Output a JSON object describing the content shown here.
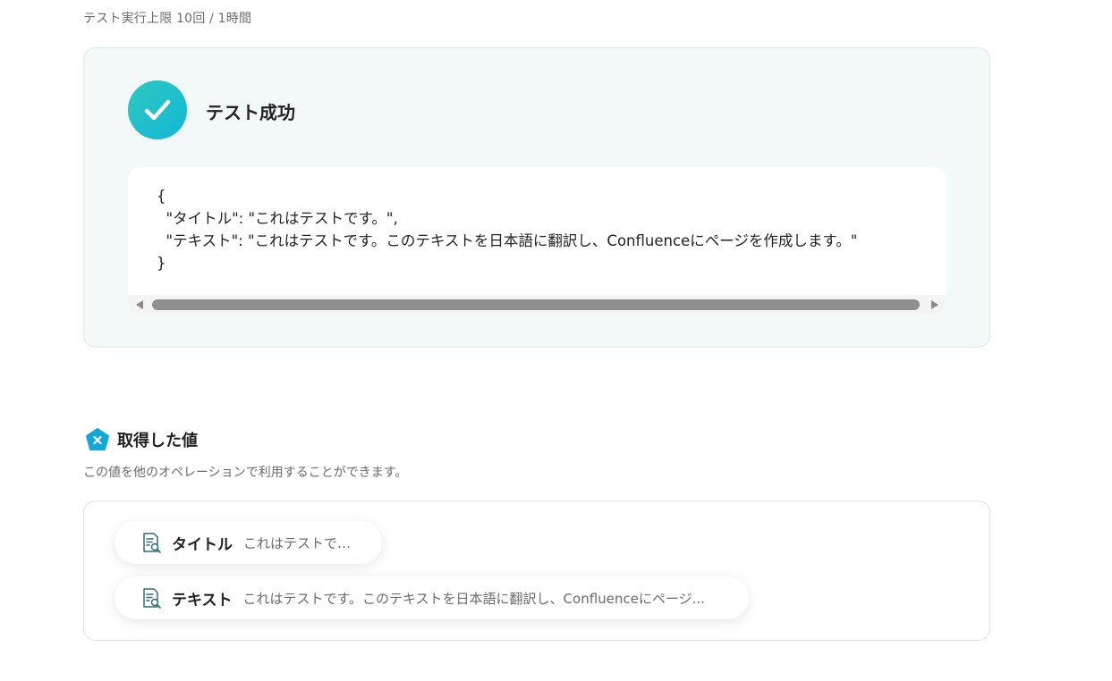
{
  "test_limit": "テスト実行上限 10回 / 1時間",
  "result": {
    "status_title": "テスト成功",
    "json_output": "{\n  \"タイトル\": \"これはテストです。\",\n  \"テキスト\": \"これはテストです。このテキストを日本語に翻訳し、Confluenceにページを作成します。\"\n}"
  },
  "retrieved_values": {
    "title": "取得した値",
    "description": "この値を他のオペレーションで利用することができます。",
    "items": [
      {
        "label": "タイトル",
        "value": "これはテストです。"
      },
      {
        "label": "テキスト",
        "value": "これはテストです。このテキストを日本語に翻訳し、Confluenceにページ..."
      }
    ]
  },
  "colors": {
    "accent_gradient_start": "#2ec9c0",
    "accent_gradient_end": "#12b7d6",
    "card_background": "#f3f9f9",
    "item_icon": "#2f6e73"
  },
  "icons": {
    "success": "check-circle-icon",
    "values_header": "pentagon-x-icon",
    "item": "document-search-icon"
  }
}
